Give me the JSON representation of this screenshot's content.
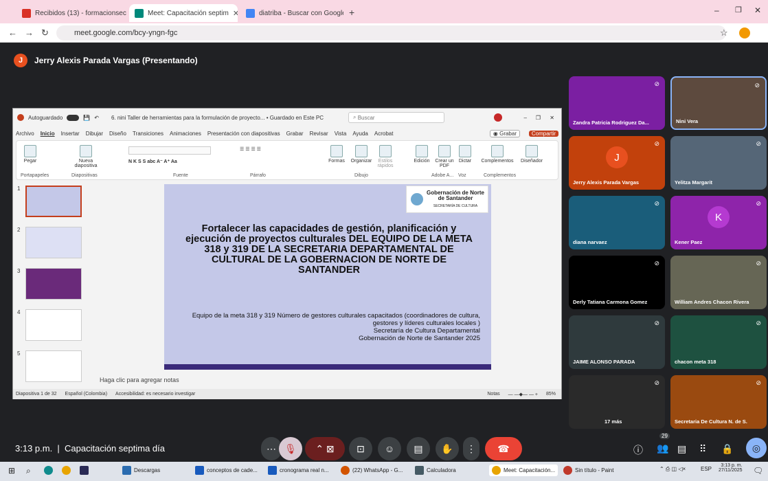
{
  "browser": {
    "tabs": [
      {
        "label": "Recibidos (13) - formacionsecr"
      },
      {
        "label": "Meet: Capacitación septim"
      },
      {
        "label": "diatriba - Buscar con Google"
      }
    ],
    "url": "meet.google.com/bcy-yngn-fgc"
  },
  "meet": {
    "presenter": "Jerry Alexis Parada Vargas (Presentando)",
    "presenter_initial": "J",
    "time": "3:13 p.m.",
    "meeting_title": "Capacitación septima día",
    "participant_count": "29",
    "more_label": "17 más"
  },
  "ppt": {
    "autosave": "Autoguardado",
    "filename": "6. nini Taller de herramientas para la formulación de proyecto... • Guardado en Este PC",
    "search_placeholder": "Buscar",
    "menu": [
      "Archivo",
      "Inicio",
      "Insertar",
      "Dibujar",
      "Diseño",
      "Transiciones",
      "Animaciones",
      "Presentación con diapositivas",
      "Grabar",
      "Revisar",
      "Vista",
      "Ayuda",
      "Acrobat"
    ],
    "grabar": "Grabar",
    "compartir": "Compartir",
    "groups": [
      "Portapapeles",
      "Diapositivas",
      "Fuente",
      "Párrafo",
      "Dibujo",
      "Adobe A...",
      "Voz",
      "Complementos"
    ],
    "buttons": {
      "pegar": "Pegar",
      "nueva": "Nueva diapositiva",
      "formas": "Formas",
      "organizar": "Organizar",
      "estilos": "Estilos rápidos",
      "edicion": "Edición",
      "crear_pdf": "Crear un PDF",
      "dictar": "Dictar",
      "complementos": "Complementos",
      "disenador": "Diseñador"
    },
    "slide_title": "Fortalecer las capacidades de gestión, planificación y ejecución de proyectos culturales DEL EQUIPO DE LA META 318 y 319 DE LA SECRETARIA DEPARTAMENTAL DE CULTURAL DE LA GOBERNACION DE NORTE DE SANTANDER",
    "slide_sub": [
      "Equipo de la meta 318 y 319 Número de gestores culturales capacitados (coordinadores de cultura, gestores y líderes culturales locales )",
      "Secretaría de Cultura Departamental",
      "Gobernación de Norte de Santander 2025"
    ],
    "logo": "Gobernación de Norte de Santander",
    "logo_sub": "SECRETARÍA DE CULTURA",
    "notes": "Haga clic para agregar notas",
    "status": {
      "slide": "Diapositiva 1 de 32",
      "lang": "Español (Colombia)",
      "access": "Accesibilidad: es necesario investigar",
      "notas": "Notas",
      "zoom": "85%"
    },
    "thumb_numbers": [
      "1",
      "2",
      "3",
      "4",
      "5"
    ]
  },
  "participants": [
    {
      "name": "Zandra Patricia Rodriguez Da...",
      "color": "#7b1fa2"
    },
    {
      "name": "Nini Vera",
      "color": "#5d4a3e"
    },
    {
      "name": "Jerry Alexis Parada Vargas",
      "color": "#c2410c",
      "initial": "J"
    },
    {
      "name": "Yelitza Margarit",
      "color": "#556677"
    },
    {
      "name": "diana narvaez",
      "color": "#1a5d7a"
    },
    {
      "name": "Kener Paez",
      "color": "#8e24aa",
      "initial": "K"
    },
    {
      "name": "Derly Tatiana Carmona Gomez",
      "color": "#000000"
    },
    {
      "name": "William Andres Chacon Rivera",
      "color": "#666655"
    },
    {
      "name": "JAIME ALONSO PARADA",
      "color": "#2f3a3d"
    },
    {
      "name": "chacon meta 318",
      "color": "#1e5140"
    },
    {
      "name": "",
      "color": "#2a2a2a"
    },
    {
      "name": "Secretaria De Cultura N. de S.",
      "color": "#9a4a10"
    }
  ],
  "taskbar": {
    "items": [
      "Descargas",
      "conceptos de cade...",
      "cronograma real n...",
      "(22) WhatsApp - G...",
      "Calculadora",
      "Meet: Capacitación...",
      "Sin título - Paint"
    ],
    "lang": "ESP",
    "time": "3:13 p. m.",
    "date": "27/11/2025"
  }
}
